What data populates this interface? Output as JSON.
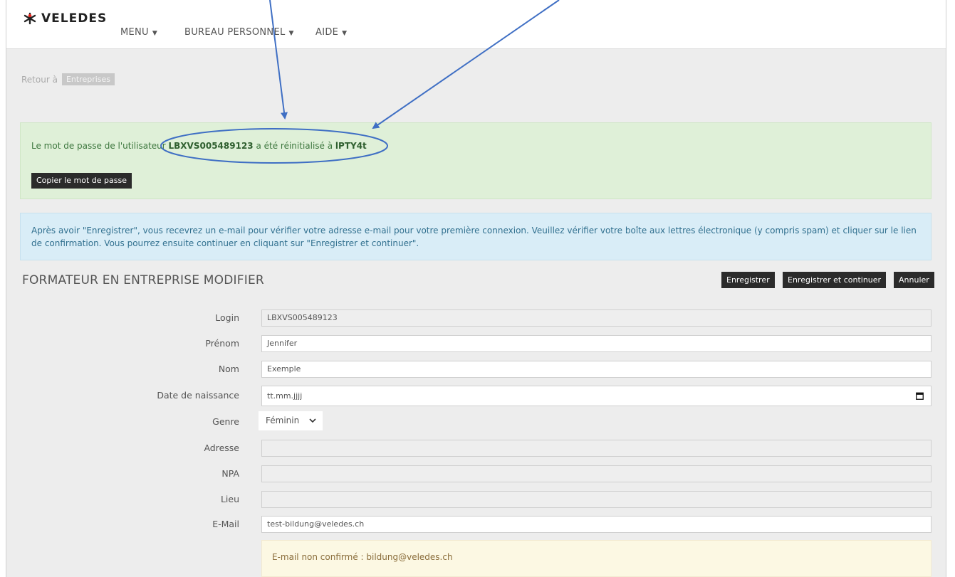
{
  "navbar": {
    "logo": "VELEDES",
    "items": [
      {
        "label": "MENU"
      },
      {
        "label": "BUREAU PERSONNEL"
      },
      {
        "label": "AIDE"
      }
    ]
  },
  "breadcrumb": {
    "prefix": "Retour à",
    "link": "Entreprises"
  },
  "success_alert": {
    "text_before": "Le mot de passe de l'utilisateur ",
    "username": "LBXVS005489123",
    "text_middle": " a été réinitialisé à ",
    "password": "lPTY4t",
    "copy_button": "Copier le mot de passe"
  },
  "info_alert": {
    "text": "Après avoir \"Enregistrer\", vous recevrez un e-mail pour vérifier votre adresse e-mail pour votre première connexion. Veuillez vérifier votre boîte aux lettres électronique (y compris spam) et cliquer sur le lien de confirmation. Vous pourrez ensuite continuer en cliquant sur \"Enregistrer et continuer\"."
  },
  "page": {
    "title": "FORMATEUR EN ENTREPRISE MODIFIER",
    "save": "Enregistrer",
    "save_continue": "Enregistrer et continuer",
    "cancel": "Annuler"
  },
  "form": {
    "login": {
      "label": "Login",
      "value": "LBXVS005489123"
    },
    "first_name": {
      "label": "Prénom",
      "value": "Jennifer"
    },
    "last_name": {
      "label": "Nom",
      "value": "Exemple"
    },
    "birthdate": {
      "label": "Date de naissance",
      "placeholder": "tt.mm.jjjj"
    },
    "gender": {
      "label": "Genre",
      "value": "Féminin"
    },
    "address": {
      "label": "Adresse",
      "value": ""
    },
    "zip": {
      "label": "NPA",
      "value": ""
    },
    "city": {
      "label": "Lieu",
      "value": ""
    },
    "email": {
      "label": "E-Mail",
      "value": "test-bildung@veledes.ch"
    }
  },
  "email_warning": {
    "text": "E-mail non confirmé : bildung@veledes.ch"
  },
  "colors": {
    "success_bg": "#dff0d8",
    "info_bg": "#d9edf7",
    "warning_bg": "#fcf8e3",
    "button_dark": "#2b2b2b",
    "annotation": "#3f6fc4"
  }
}
